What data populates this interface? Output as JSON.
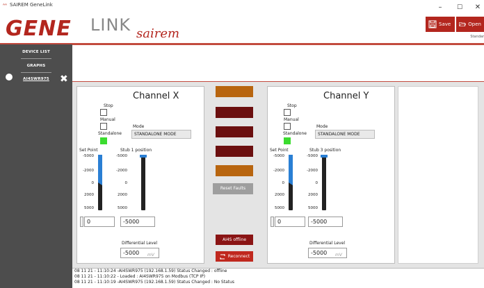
{
  "window": {
    "title": "SAIREM GeneLink",
    "minimize": "–",
    "maximize": "☐",
    "close": "✕"
  },
  "logo": {
    "gene": "GENE",
    "link": "LINK",
    "brand": "sairem"
  },
  "toolbar": {
    "save_label": "Save",
    "open_label": "Open",
    "mode_label": "Standar"
  },
  "sidebar": {
    "device_list": "DEVICE LIST",
    "graphs": "GRAPHS",
    "device": "AI4SWR975",
    "close_glyph": "✖"
  },
  "channel_x": {
    "title": "Channel X",
    "stop": "Stop",
    "manual": "Manual",
    "standalone": "Standalone",
    "mode_label": "Mode",
    "mode_value": "STANDALONE MODE",
    "setpoint_label": "Set Point",
    "stub_label": "Stub 1 position",
    "ticks": [
      "-5000",
      "-2000",
      "0",
      "2000",
      "5000"
    ],
    "setpoint_value": "0",
    "stub_value": "-5000",
    "diff_label": "Differential Level",
    "diff_value": "-5000",
    "diff_unit": "mV"
  },
  "channel_y": {
    "title": "Channel Y",
    "stop": "Stop",
    "manual": "Manual",
    "standalone": "Standalone",
    "mode_label": "Mode",
    "mode_value": "STANDALONE MODE",
    "setpoint_label": "Set Point",
    "stub_label": "Stub 3 position",
    "ticks": [
      "-5000",
      "-2000",
      "0",
      "2000",
      "5000"
    ],
    "setpoint_value": "0",
    "stub_value": "-5000",
    "diff_label": "Differential Level",
    "diff_value": "-5000",
    "diff_unit": "mV"
  },
  "center": {
    "bar_colors": [
      "#b8650f",
      "#6b0f0f",
      "#6b0f0f",
      "#6b0f0f",
      "#b8650f"
    ],
    "reset_label": "Reset Faults",
    "offline_label": "AI4S offline",
    "reconnect_label": "Reconnect"
  },
  "log": [
    "08 11 21 - 11:10:24 -AI4SWR975 (192.168.1.59) Status Changed : offline",
    "08 11 21 - 11:10:22 - Loaded : AI4SWR975 on Modbus (TCP IP)",
    "08 11 21 - 11:10:19 -AI4SWR975 (192.168.1.59) Status Changed : No Status"
  ],
  "colors": {
    "brand_red": "#b3261e",
    "sidebar_bg": "#4d4d4d",
    "indicator_green": "#3bdc2f",
    "slider_blue": "#2a7fd4"
  }
}
